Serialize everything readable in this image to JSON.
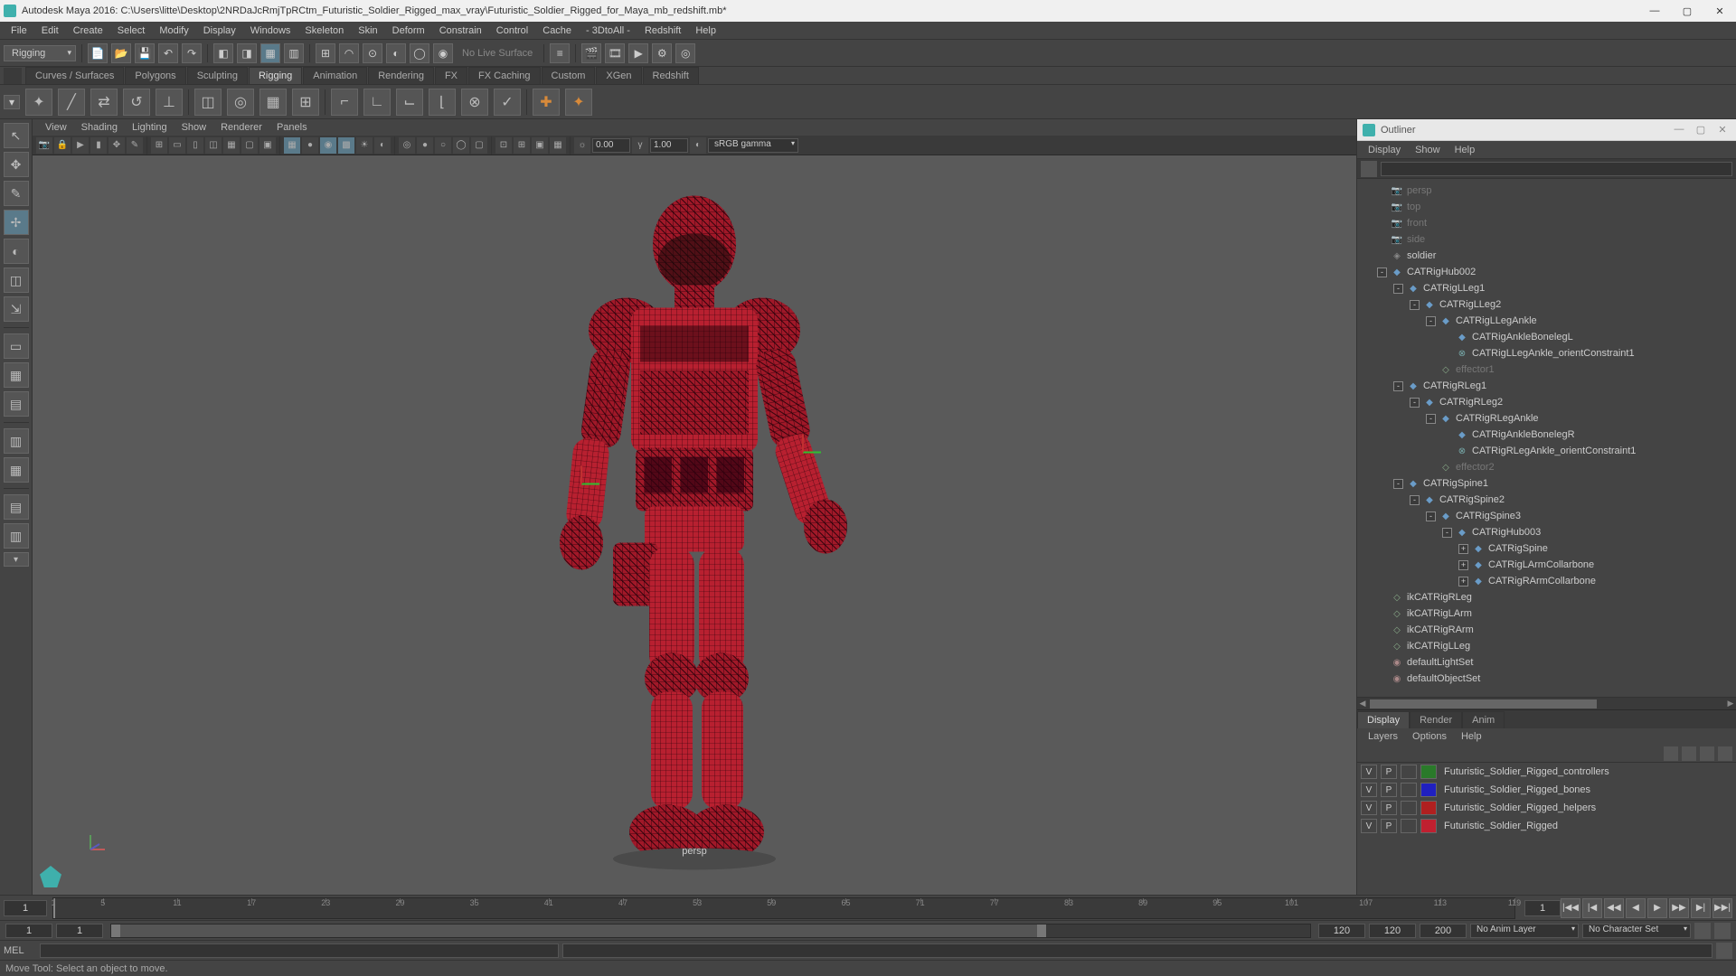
{
  "titlebar": {
    "text": "Autodesk Maya 2016: C:\\Users\\litte\\Desktop\\2NRDaJcRmjTpRCtm_Futuristic_Soldier_Rigged_max_vray\\Futuristic_Soldier_Rigged_for_Maya_mb_redshift.mb*"
  },
  "menubar": [
    "File",
    "Edit",
    "Create",
    "Select",
    "Modify",
    "Display",
    "Windows",
    "Skeleton",
    "Skin",
    "Deform",
    "Constrain",
    "Control",
    "Cache",
    "- 3DtoAll -",
    "Redshift",
    "Help"
  ],
  "toolbar": {
    "workspace": "Rigging",
    "surface_label": "No Live Surface"
  },
  "shelf_tabs": [
    "Curves / Surfaces",
    "Polygons",
    "Sculpting",
    "Rigging",
    "Animation",
    "Rendering",
    "FX",
    "FX Caching",
    "Custom",
    "XGen",
    "Redshift"
  ],
  "shelf_active": "Rigging",
  "panel_menu": [
    "View",
    "Shading",
    "Lighting",
    "Show",
    "Renderer",
    "Panels"
  ],
  "panel_toolbar": {
    "exposure": "0.00",
    "gamma": "1.00",
    "colorspace": "sRGB gamma"
  },
  "viewport": {
    "name": "persp"
  },
  "outliner": {
    "title": "Outliner",
    "menu": [
      "Display",
      "Show",
      "Help"
    ],
    "tree": [
      {
        "depth": 0,
        "exp": "",
        "icon": "cam",
        "label": "persp",
        "dim": true
      },
      {
        "depth": 0,
        "exp": "",
        "icon": "cam",
        "label": "top",
        "dim": true
      },
      {
        "depth": 0,
        "exp": "",
        "icon": "cam",
        "label": "front",
        "dim": true
      },
      {
        "depth": 0,
        "exp": "",
        "icon": "cam",
        "label": "side",
        "dim": true
      },
      {
        "depth": 0,
        "exp": "",
        "icon": "grp",
        "label": "soldier"
      },
      {
        "depth": 0,
        "exp": "-",
        "icon": "joint",
        "label": "CATRigHub002"
      },
      {
        "depth": 1,
        "exp": "-",
        "icon": "joint",
        "label": "CATRigLLeg1"
      },
      {
        "depth": 2,
        "exp": "-",
        "icon": "joint",
        "label": "CATRigLLeg2"
      },
      {
        "depth": 3,
        "exp": "-",
        "icon": "joint",
        "label": "CATRigLLegAnkle"
      },
      {
        "depth": 4,
        "exp": "",
        "icon": "joint",
        "label": "CATRigAnkleBonelegL"
      },
      {
        "depth": 4,
        "exp": "",
        "icon": "constraint",
        "label": "CATRigLLegAnkle_orientConstraint1"
      },
      {
        "depth": 3,
        "exp": "",
        "icon": "ik",
        "label": "effector1",
        "dim": true
      },
      {
        "depth": 1,
        "exp": "-",
        "icon": "joint",
        "label": "CATRigRLeg1"
      },
      {
        "depth": 2,
        "exp": "-",
        "icon": "joint",
        "label": "CATRigRLeg2"
      },
      {
        "depth": 3,
        "exp": "-",
        "icon": "joint",
        "label": "CATRigRLegAnkle"
      },
      {
        "depth": 4,
        "exp": "",
        "icon": "joint",
        "label": "CATRigAnkleBonelegR"
      },
      {
        "depth": 4,
        "exp": "",
        "icon": "constraint",
        "label": "CATRigRLegAnkle_orientConstraint1"
      },
      {
        "depth": 3,
        "exp": "",
        "icon": "ik",
        "label": "effector2",
        "dim": true
      },
      {
        "depth": 1,
        "exp": "-",
        "icon": "joint",
        "label": "CATRigSpine1"
      },
      {
        "depth": 2,
        "exp": "-",
        "icon": "joint",
        "label": "CATRigSpine2"
      },
      {
        "depth": 3,
        "exp": "-",
        "icon": "joint",
        "label": "CATRigSpine3"
      },
      {
        "depth": 4,
        "exp": "-",
        "icon": "joint",
        "label": "CATRigHub003"
      },
      {
        "depth": 5,
        "exp": "+",
        "icon": "joint",
        "label": "CATRigSpine"
      },
      {
        "depth": 5,
        "exp": "+",
        "icon": "joint",
        "label": "CATRigLArmCollarbone"
      },
      {
        "depth": 5,
        "exp": "+",
        "icon": "joint",
        "label": "CATRigRArmCollarbone"
      },
      {
        "depth": 0,
        "exp": "",
        "icon": "ik",
        "label": "ikCATRigRLeg"
      },
      {
        "depth": 0,
        "exp": "",
        "icon": "ik",
        "label": "ikCATRigLArm"
      },
      {
        "depth": 0,
        "exp": "",
        "icon": "ik",
        "label": "ikCATRigRArm"
      },
      {
        "depth": 0,
        "exp": "",
        "icon": "ik",
        "label": "ikCATRigLLeg"
      },
      {
        "depth": 0,
        "exp": "",
        "icon": "set",
        "label": "defaultLightSet"
      },
      {
        "depth": 0,
        "exp": "",
        "icon": "set",
        "label": "defaultObjectSet"
      }
    ]
  },
  "layers": {
    "tabs": [
      "Display",
      "Render",
      "Anim"
    ],
    "active_tab": "Display",
    "menu": [
      "Layers",
      "Options",
      "Help"
    ],
    "rows": [
      {
        "v": "V",
        "p": "P",
        "color": "#2a7a2a",
        "name": "Futuristic_Soldier_Rigged_controllers"
      },
      {
        "v": "V",
        "p": "P",
        "color": "#2020c0",
        "name": "Futuristic_Soldier_Rigged_bones"
      },
      {
        "v": "V",
        "p": "P",
        "color": "#b02020",
        "name": "Futuristic_Soldier_Rigged_helpers"
      },
      {
        "v": "V",
        "p": "P",
        "color": "#c02030",
        "name": "Futuristic_Soldier_Rigged"
      }
    ]
  },
  "timeslider": {
    "start": "1",
    "ticks": [
      1,
      5,
      11,
      17,
      23,
      29,
      35,
      41,
      47,
      53,
      59,
      65,
      71,
      77,
      83,
      89,
      95,
      101,
      107,
      113,
      119
    ],
    "current": "1",
    "playback": [
      "|◀◀",
      "|◀",
      "◀◀",
      "◀",
      "▶",
      "▶▶",
      "▶|",
      "▶▶|"
    ]
  },
  "rangeslider": {
    "startOuter": "1",
    "startInner": "1",
    "endInner": "120",
    "endOuter": "120",
    "endRange": "200",
    "animLayer": "No Anim Layer",
    "charSet": "No Character Set"
  },
  "cmdline": {
    "label": "MEL"
  },
  "helpline": {
    "text": "Move Tool: Select an object to move."
  }
}
